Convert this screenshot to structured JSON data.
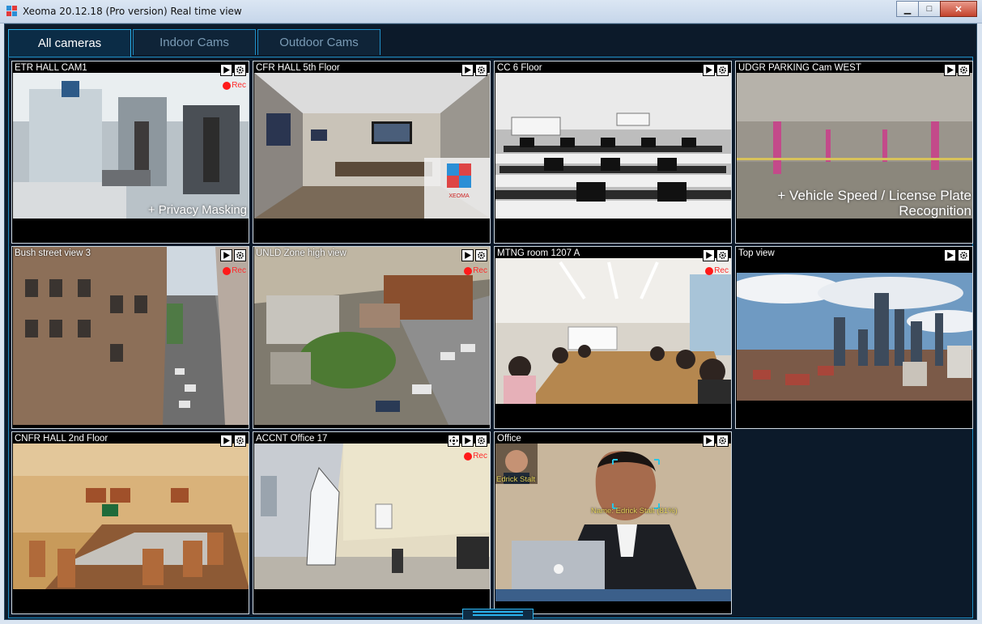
{
  "window": {
    "title": "Xeoma 20.12.18 (Pro version) Real time view",
    "min_symbol": "▁",
    "max_symbol": "□",
    "close_symbol": "✕"
  },
  "tabs": [
    {
      "label": "All cameras",
      "active": true
    },
    {
      "label": "Indoor Cams",
      "active": false
    },
    {
      "label": "Outdoor Cams",
      "active": false
    }
  ],
  "cameras": [
    {
      "title": "ETR HALL CAM1",
      "rec": true,
      "overlay": "+ Privacy Masking"
    },
    {
      "title": "CFR HALL 5th Floor",
      "rec": false,
      "overlay": "",
      "logo_text": "XEOMA"
    },
    {
      "title": "CC 6 Floor",
      "rec": false,
      "overlay": ""
    },
    {
      "title": "UDGR PARKING Cam WEST",
      "rec": false,
      "overlay": "+ Vehicle Speed / License Plate\nRecognition"
    },
    {
      "title": "Bush street view 3",
      "rec": true,
      "overlay": ""
    },
    {
      "title": "UNLD Zone high view",
      "rec": true,
      "overlay": ""
    },
    {
      "title": "MTNG room 1207 A",
      "rec": true,
      "overlay": ""
    },
    {
      "title": "Top view",
      "rec": false,
      "overlay": ""
    },
    {
      "title": "CNFR HALL 2nd Floor",
      "rec": false,
      "overlay": ""
    },
    {
      "title": "ACCNT Office 17",
      "rec": true,
      "overlay": "",
      "has_move_button": true
    },
    {
      "title": "Office",
      "rec": false,
      "overlay": "",
      "face_thumb_name": "Edrick Stalt",
      "face_label": "Name: Edrick Stalt (81%)"
    }
  ],
  "rec_label": "Rec",
  "colors": {
    "accent": "#2ab2ec",
    "background": "#0c1a2a",
    "rec": "#ff1a1a",
    "face_box": "#29c6e6",
    "face_label": "#e4d35a"
  },
  "icons": {
    "play": "play-icon",
    "settings": "gear-icon",
    "move": "move-icon"
  }
}
